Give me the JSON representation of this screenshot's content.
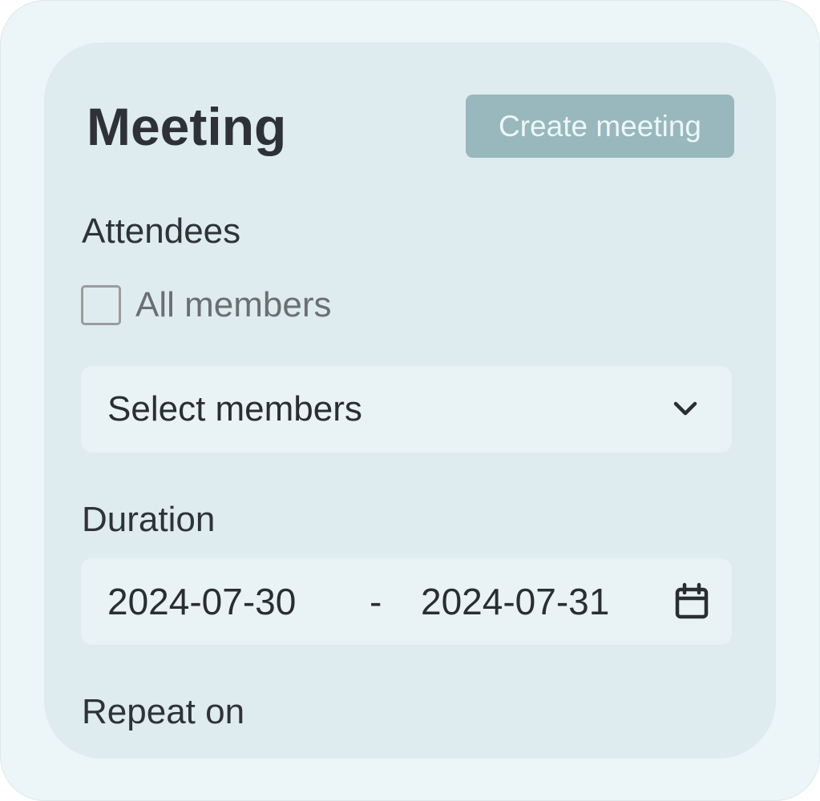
{
  "header": {
    "title": "Meeting",
    "create_button_label": "Create meeting"
  },
  "attendees": {
    "label": "Attendees",
    "all_members_label": "All members",
    "all_members_checked": false,
    "select": {
      "value": "Select members",
      "icon": "chevron-down-icon"
    }
  },
  "duration": {
    "label": "Duration",
    "start_date": "2024-07-30",
    "separator": "-",
    "end_date": "2024-07-31",
    "icon": "calendar-icon"
  },
  "repeat": {
    "label": "Repeat on"
  },
  "colors": {
    "outer_background": "#ecf5f7",
    "card_background": "#deecef",
    "field_background": "#e9f2f4",
    "button_background": "#98b8bd",
    "button_text": "#eef6f7",
    "text": "#2f3336"
  }
}
